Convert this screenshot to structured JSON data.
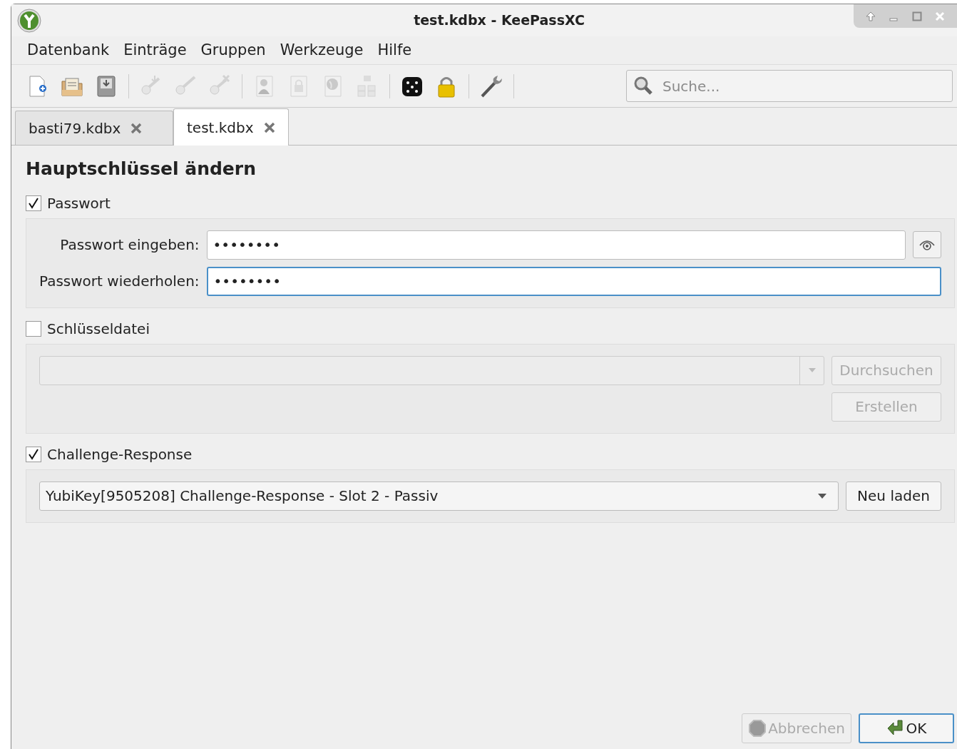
{
  "window": {
    "title": "test.kdbx - KeePassXC"
  },
  "menu": [
    "Datenbank",
    "Einträge",
    "Gruppen",
    "Werkzeuge",
    "Hilfe"
  ],
  "toolbar": [
    {
      "kind": "new",
      "disabled": false
    },
    {
      "kind": "open",
      "disabled": false
    },
    {
      "kind": "save",
      "disabled": false
    },
    {
      "kind": "sep"
    },
    {
      "kind": "key-add",
      "disabled": true
    },
    {
      "kind": "key-edit",
      "disabled": true
    },
    {
      "kind": "key-delete",
      "disabled": true
    },
    {
      "kind": "sep"
    },
    {
      "kind": "user",
      "disabled": true
    },
    {
      "kind": "lock-page",
      "disabled": true
    },
    {
      "kind": "globe",
      "disabled": true
    },
    {
      "kind": "tree",
      "disabled": true
    },
    {
      "kind": "sep"
    },
    {
      "kind": "dice",
      "disabled": false
    },
    {
      "kind": "lock",
      "disabled": false
    },
    {
      "kind": "sep"
    },
    {
      "kind": "wrench",
      "disabled": false
    },
    {
      "kind": "sep"
    }
  ],
  "search": {
    "placeholder": "Suche..."
  },
  "tabs": [
    {
      "label": "basti79.kdbx",
      "selected": false
    },
    {
      "label": "test.kdbx",
      "selected": true
    }
  ],
  "heading": "Hauptschlüssel ändern",
  "password": {
    "label": "Passwort",
    "checked": true,
    "enter_label": "Passwort eingeben:",
    "enter_value": "••••••••",
    "repeat_label": "Passwort wiederholen:",
    "repeat_value": "••••••••",
    "repeat_focused": true
  },
  "keyfile": {
    "label": "Schlüsseldatei",
    "checked": false,
    "buttons": [
      "Durchsuchen",
      "Erstellen"
    ]
  },
  "challenge": {
    "label": "Challenge-Response",
    "checked": true,
    "device": "YubiKey[9505208] Challenge-Response - Slot 2 - Passiv",
    "button": "Neu laden"
  },
  "footer": [
    {
      "label": "Abbrechen",
      "disabled": true,
      "kind": "cancel"
    },
    {
      "label": "OK",
      "disabled": false,
      "kind": "ok"
    }
  ]
}
